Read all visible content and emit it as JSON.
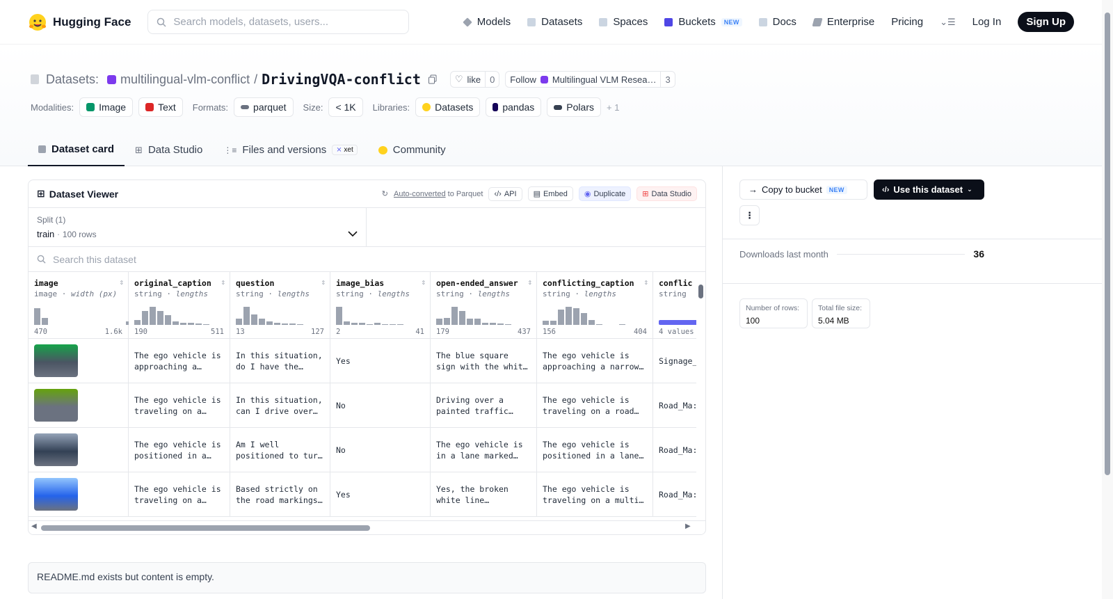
{
  "header": {
    "brand": "Hugging Face",
    "search_placeholder": "Search models, datasets, users...",
    "nav": [
      {
        "label": "Models",
        "icon": "models-icon"
      },
      {
        "label": "Datasets",
        "icon": "datasets-icon"
      },
      {
        "label": "Spaces",
        "icon": "spaces-icon"
      },
      {
        "label": "Buckets",
        "icon": "buckets-icon",
        "badge": "NEW"
      },
      {
        "label": "Docs",
        "icon": "docs-icon"
      },
      {
        "label": "Enterprise",
        "icon": "enterprise-icon"
      },
      {
        "label": "Pricing"
      }
    ],
    "login": "Log In",
    "signup": "Sign Up"
  },
  "title": {
    "section": "Datasets:",
    "org": "multilingual-vlm-conflict",
    "sep": "/",
    "name": "DrivingVQA-conflict",
    "like": "like",
    "like_count": "0",
    "follow": "Follow",
    "follow_org": "Multilingual VLM Resea…",
    "follow_count": "3"
  },
  "meta": {
    "modalities_label": "Modalities:",
    "modalities": [
      "Image",
      "Text"
    ],
    "formats_label": "Formats:",
    "format": "parquet",
    "size_label": "Size:",
    "size": "< 1K",
    "libraries_label": "Libraries:",
    "libraries": [
      "Datasets",
      "pandas",
      "Polars"
    ],
    "more": "+ 1"
  },
  "tabs": [
    "Dataset card",
    "Data Studio",
    "Files and versions",
    "Community"
  ],
  "xet": "xet",
  "viewer": {
    "title": "Dataset Viewer",
    "auto": "Auto-converted",
    "auto_rest": "to Parquet",
    "api": "API",
    "embed": "Embed",
    "duplicate": "Duplicate",
    "data_studio": "Data Studio",
    "split_label": "Split (1)",
    "split": "train",
    "rows": "100 rows",
    "search_placeholder": "Search this dataset"
  },
  "columns": [
    {
      "name": "image",
      "type": "image",
      "stat": "width (px)",
      "min": "470",
      "max": "1.6k",
      "hist": [
        24,
        10,
        0,
        0,
        0,
        0,
        0,
        0,
        0,
        0,
        0,
        0,
        5
      ]
    },
    {
      "name": "original_caption",
      "type": "string",
      "stat": "lengths",
      "min": "190",
      "max": "511",
      "hist": [
        7,
        20,
        26,
        20,
        14,
        5,
        3,
        3,
        2,
        1
      ]
    },
    {
      "name": "question",
      "type": "string",
      "stat": "lengths",
      "min": "13",
      "max": "127",
      "hist": [
        9,
        26,
        15,
        9,
        5,
        3,
        2,
        2,
        1
      ]
    },
    {
      "name": "image_bias",
      "type": "string",
      "stat": "lengths",
      "min": "2",
      "max": "41",
      "hist": [
        26,
        5,
        3,
        3,
        1,
        3,
        1,
        1,
        1
      ]
    },
    {
      "name": "open-ended_answer",
      "type": "string",
      "stat": "lengths",
      "min": "179",
      "max": "437",
      "hist": [
        9,
        10,
        26,
        20,
        9,
        9,
        3,
        3,
        2,
        1
      ]
    },
    {
      "name": "conflicting_caption",
      "type": "string",
      "stat": "lengths",
      "min": "156",
      "max": "404",
      "hist": [
        6,
        6,
        22,
        26,
        24,
        17,
        7,
        1,
        0,
        0,
        1
      ]
    },
    {
      "name": "conflic",
      "type": "string",
      "stat": "",
      "min": "4 values",
      "max": "",
      "hist": []
    }
  ],
  "rows": [
    [
      "",
      "The ego vehicle is approaching a…",
      "In this situation, do I have the…",
      "Yes",
      "The blue square sign with the whit…",
      "The ego vehicle is approaching a narrow…",
      "Signage_"
    ],
    [
      "",
      "The ego vehicle is traveling on a…",
      "In this situation, can I drive over…",
      "No",
      "Driving over a painted traffic…",
      "The ego vehicle is traveling on a road…",
      "Road_Ma:"
    ],
    [
      "",
      "The ego vehicle is positioned in a…",
      "Am I well positioned to tur…",
      "No",
      "The ego vehicle is in a lane marked…",
      "The ego vehicle is positioned in a lane…",
      "Road_Ma:"
    ],
    [
      "",
      "The ego vehicle is traveling on a…",
      "Based strictly on the road markings…",
      "Yes",
      "Yes, the broken white line…",
      "The ego vehicle is traveling on a multi…",
      "Road_Ma:"
    ]
  ],
  "readme": "README.md exists but content is empty.",
  "sidebar": {
    "copy": "Copy to bucket",
    "copy_badge": "NEW",
    "use": "Use this dataset",
    "downloads_label": "Downloads last month",
    "downloads": "36",
    "rows_label": "Number of rows:",
    "rows_value": "100",
    "size_label": "Total file size:",
    "size_value": "5.04 MB"
  }
}
